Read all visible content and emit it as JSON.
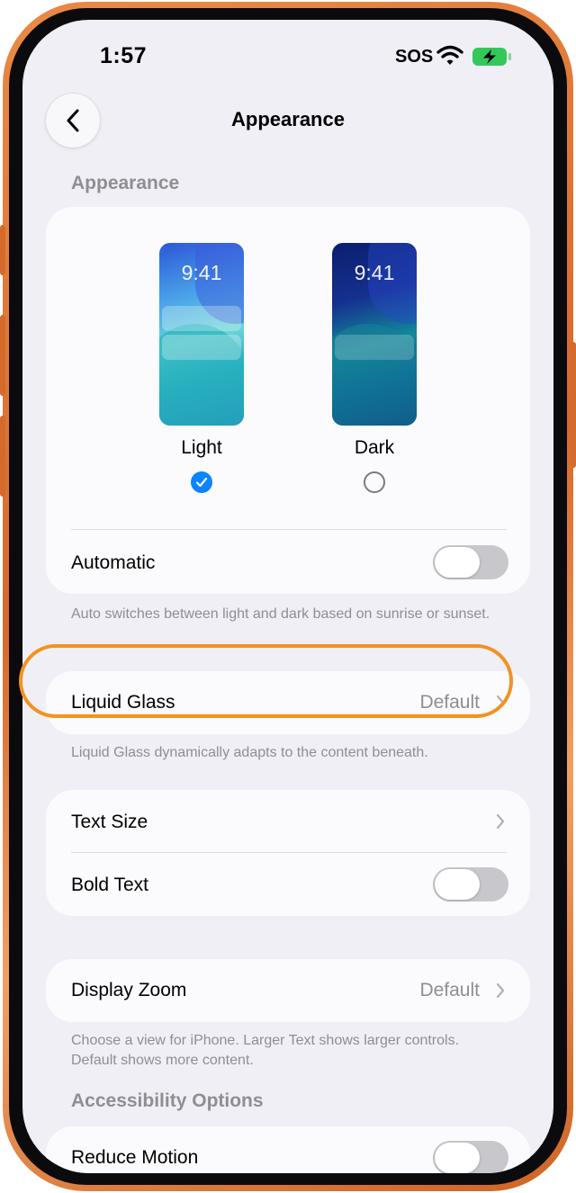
{
  "status_bar": {
    "time": "1:57",
    "sos": "SOS",
    "wifi_icon": "wifi-icon",
    "battery_icon": "battery-charging-icon",
    "battery_color": "#34c759"
  },
  "nav": {
    "title": "Appearance",
    "back_icon": "chevron-left-icon"
  },
  "appearance": {
    "header": "Appearance",
    "options": [
      {
        "label": "Light",
        "clock": "9:41",
        "selected": true
      },
      {
        "label": "Dark",
        "clock": "9:41",
        "selected": false
      }
    ],
    "automatic": {
      "label": "Automatic",
      "on": false
    },
    "footnote": "Auto switches between light and dark based on sunrise or sunset."
  },
  "liquid_glass": {
    "label": "Liquid Glass",
    "value": "Default",
    "footnote": "Liquid Glass dynamically adapts to the content beneath."
  },
  "text_settings": {
    "text_size": {
      "label": "Text Size"
    },
    "bold_text": {
      "label": "Bold Text",
      "on": false
    }
  },
  "display_zoom": {
    "label": "Display Zoom",
    "value": "Default",
    "footnote": "Choose a view for iPhone. Larger Text shows larger controls. Default shows more content."
  },
  "accessibility": {
    "header": "Accessibility Options",
    "reduce_motion": {
      "label": "Reduce Motion",
      "on": false
    }
  },
  "colors": {
    "accent": "#0a84ff",
    "highlight": "#f39220",
    "background": "#f0eff6",
    "toggle_off": "#c7c7cc"
  }
}
